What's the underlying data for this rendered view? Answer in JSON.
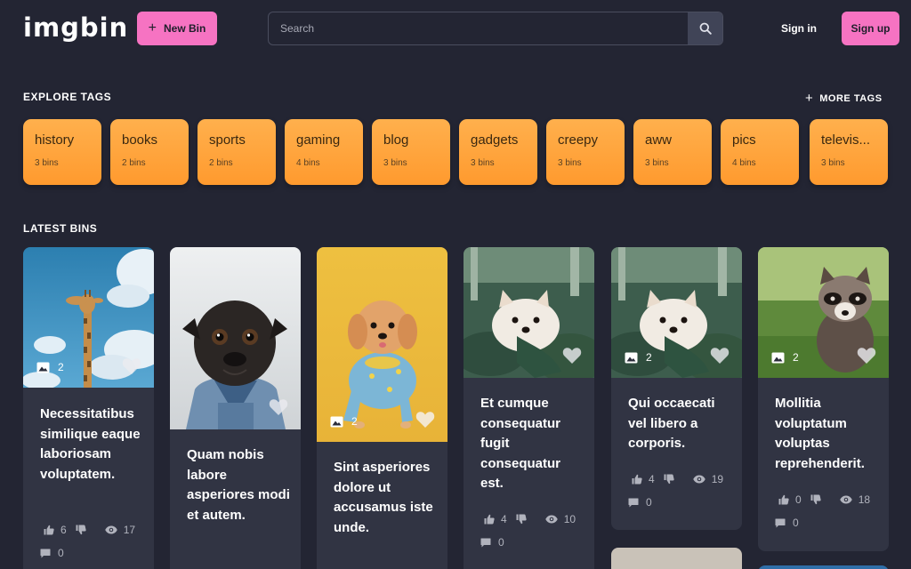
{
  "header": {
    "logo": "imgbin",
    "new_bin_label": "New Bin",
    "search_placeholder": "Search",
    "signin_label": "Sign in",
    "signup_label": "Sign up"
  },
  "explore": {
    "title": "EXPLORE TAGS",
    "more_label": "MORE TAGS",
    "tags": [
      {
        "name": "history",
        "count": "3 bins"
      },
      {
        "name": "books",
        "count": "2 bins"
      },
      {
        "name": "sports",
        "count": "2 bins"
      },
      {
        "name": "gaming",
        "count": "4 bins"
      },
      {
        "name": "blog",
        "count": "3 bins"
      },
      {
        "name": "gadgets",
        "count": "3 bins"
      },
      {
        "name": "creepy",
        "count": "3 bins"
      },
      {
        "name": "aww",
        "count": "3 bins"
      },
      {
        "name": "pics",
        "count": "4 bins"
      },
      {
        "name": "televis...",
        "count": "3 bins"
      }
    ]
  },
  "latest": {
    "title": "LATEST BINS",
    "bins": [
      {
        "title": "Necessitatibus similique eaque laboriosam voluptatem.",
        "images": "2",
        "likes": "6",
        "views": "17",
        "comments": "0",
        "image_icon": "giraffe-photo"
      },
      {
        "title": "Quam nobis labore asperiores modi et autem.",
        "images": "",
        "likes": "",
        "views": "",
        "comments": "",
        "image_icon": "pug-photo"
      },
      {
        "title": "Sint asperiores dolore ut accusamus iste unde.",
        "images": "2",
        "likes": "",
        "views": "",
        "comments": "",
        "image_icon": "poodle-photo"
      },
      {
        "title": "Et cumque consequatur fugit consequatur est.",
        "images": "",
        "likes": "4",
        "views": "10",
        "comments": "0",
        "image_icon": "pomeranian-photo"
      },
      {
        "title": "Qui occaecati vel libero a corporis.",
        "images": "2",
        "likes": "4",
        "views": "19",
        "comments": "0",
        "image_icon": "pomeranian-photo"
      },
      {
        "title": "Mollitia voluptatum voluptas reprehenderit.",
        "images": "2",
        "likes": "0",
        "views": "18",
        "comments": "0",
        "image_icon": "raccoon-photo"
      }
    ]
  },
  "colors": {
    "background": "#232533",
    "accent_pink": "#f673c2",
    "tag_orange": "#ffa53d",
    "card_bg": "#313443"
  }
}
